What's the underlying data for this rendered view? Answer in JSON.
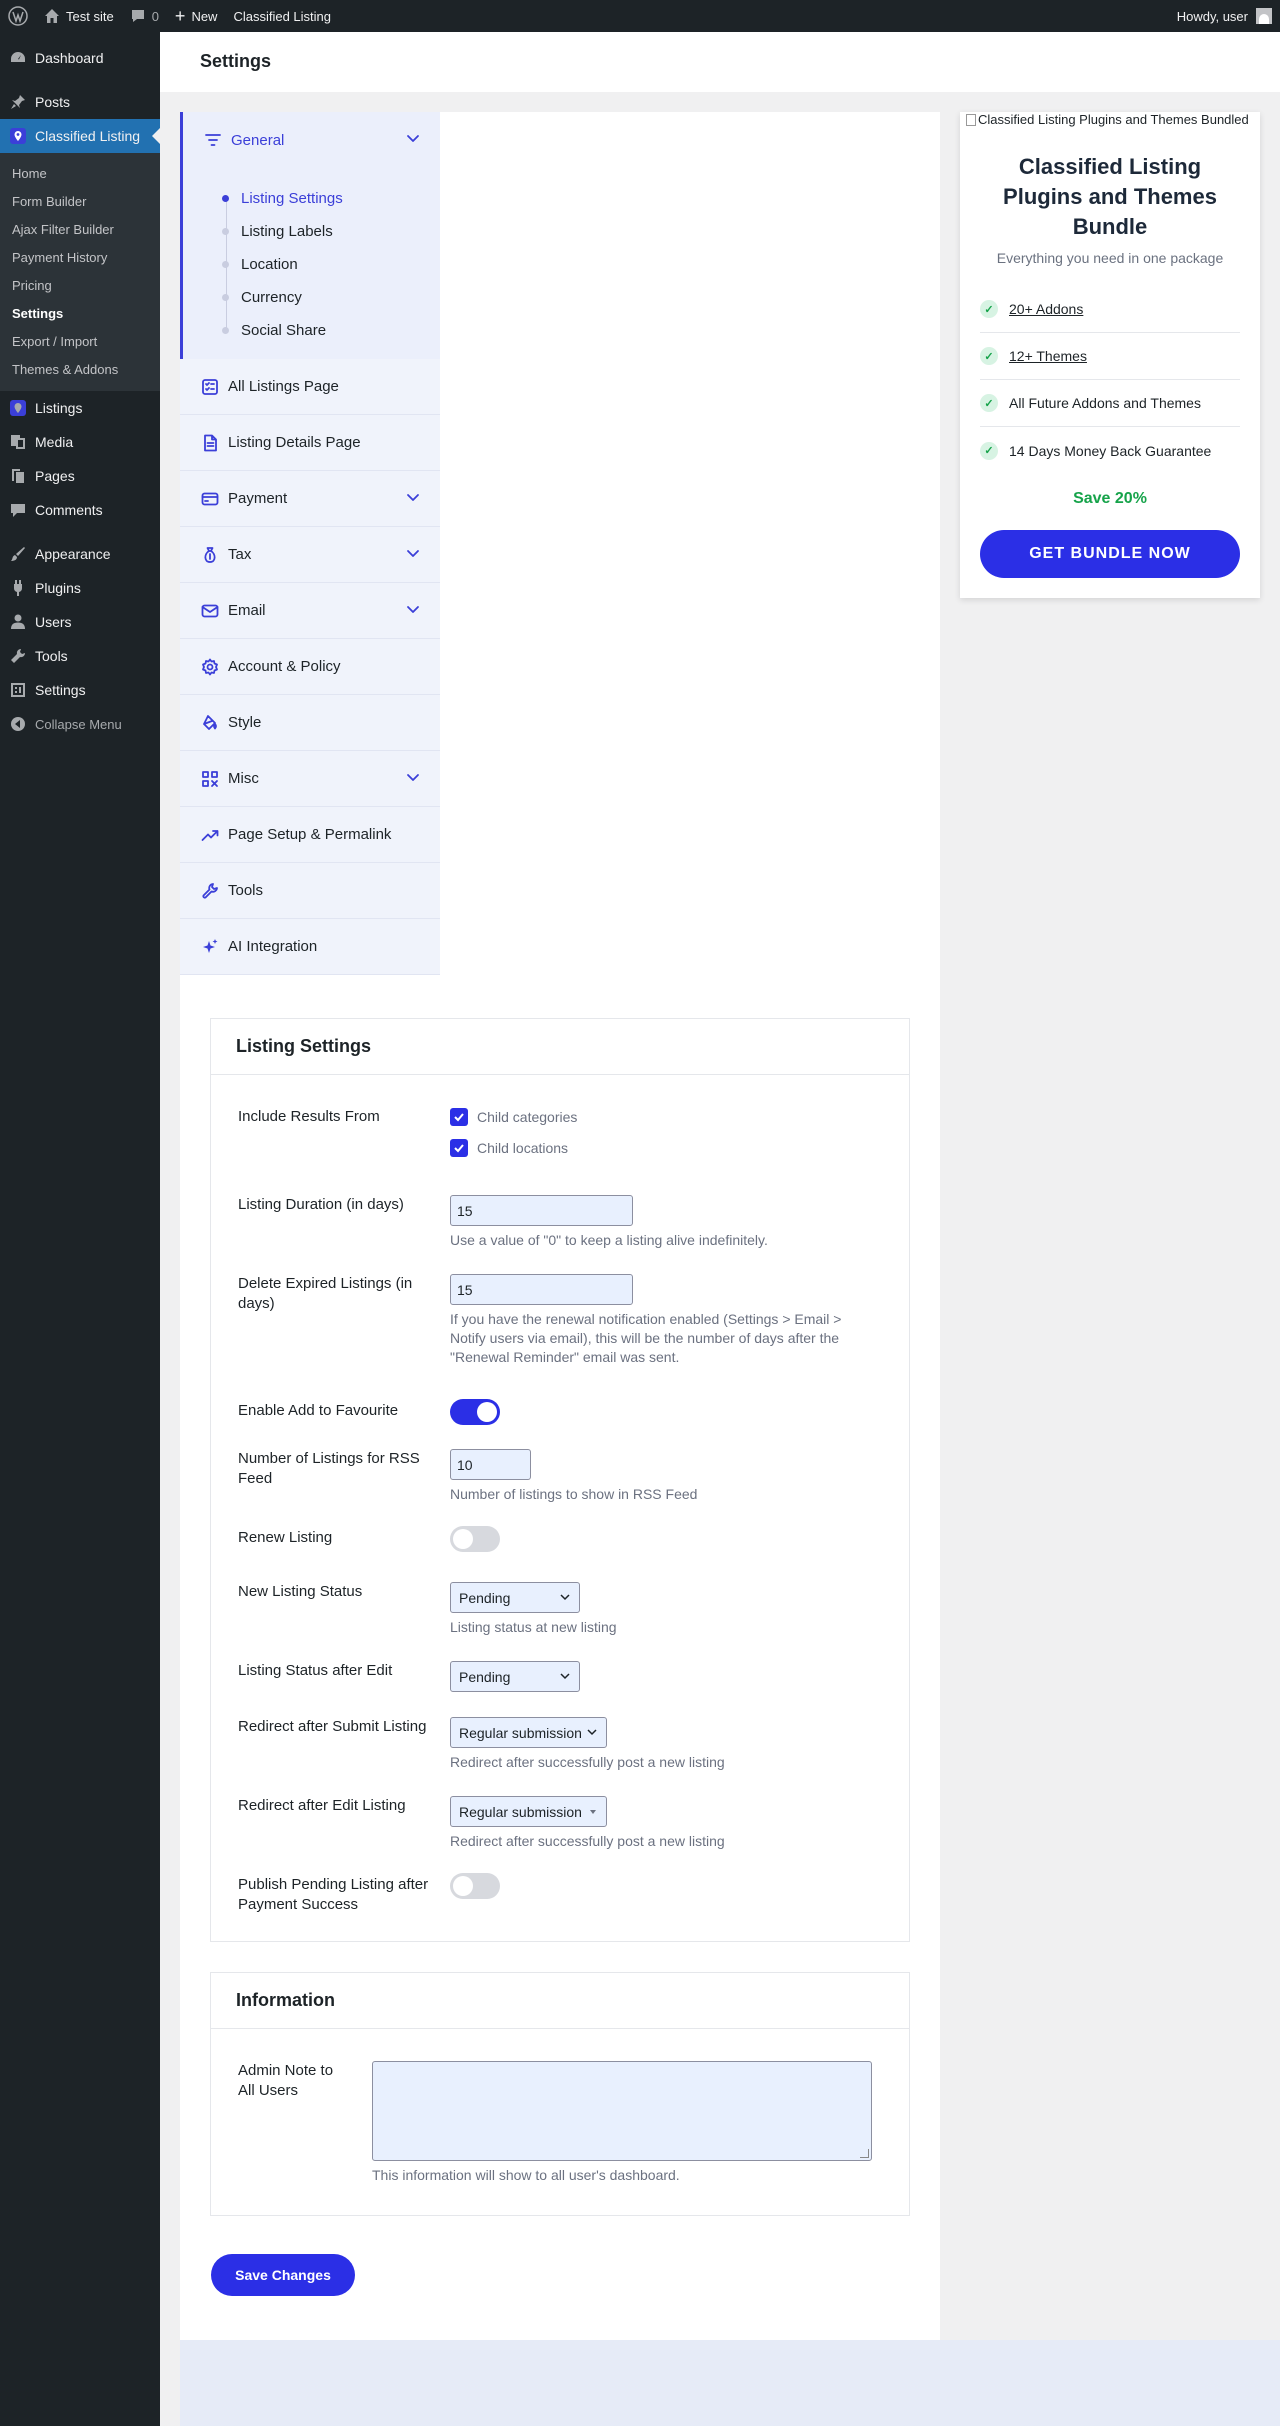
{
  "admin_bar": {
    "site_name": "Test site",
    "comments_count": "0",
    "new_label": "New",
    "plugin_label": "Classified Listing",
    "howdy": "Howdy, user"
  },
  "sidebar": {
    "dashboard": "Dashboard",
    "posts": "Posts",
    "classified_listing": "Classified Listing",
    "submenu": [
      "Home",
      "Form Builder",
      "Ajax Filter Builder",
      "Payment History",
      "Pricing",
      "Settings",
      "Export / Import",
      "Themes & Addons"
    ],
    "listings": "Listings",
    "media": "Media",
    "pages": "Pages",
    "comments": "Comments",
    "appearance": "Appearance",
    "plugins": "Plugins",
    "users": "Users",
    "tools": "Tools",
    "settings": "Settings",
    "collapse": "Collapse Menu"
  },
  "page_title": "Settings",
  "settings_nav": {
    "general": "General",
    "general_sub": [
      "Listing Settings",
      "Listing Labels",
      "Location",
      "Currency",
      "Social Share"
    ],
    "items": [
      {
        "label": "All Listings Page",
        "icon": "list-check-icon"
      },
      {
        "label": "Listing Details Page",
        "icon": "document-icon"
      },
      {
        "label": "Payment",
        "icon": "credit-card-icon"
      },
      {
        "label": "Tax",
        "icon": "money-bag-icon"
      },
      {
        "label": "Email",
        "icon": "envelope-icon"
      },
      {
        "label": "Account & Policy",
        "icon": "gear-icon"
      },
      {
        "label": "Style",
        "icon": "paint-bucket-icon"
      },
      {
        "label": "Misc",
        "icon": "grid-icon"
      },
      {
        "label": "Page Setup & Permalink",
        "icon": "trend-up-icon"
      },
      {
        "label": "Tools",
        "icon": "wrench-icon"
      },
      {
        "label": "AI Integration",
        "icon": "sparkles-icon"
      }
    ]
  },
  "promo": {
    "image_alt": "Classified Listing Plugins and Themes Bundled",
    "title": "Classified Listing Plugins and Themes Bundle",
    "subtitle": "Everything you need in one package",
    "features": [
      "20+ Addons",
      "12+ Themes",
      "All Future Addons and Themes",
      "14 Days Money Back Guarantee"
    ],
    "save": "Save 20%",
    "cta": "GET BUNDLE NOW"
  },
  "listing_settings": {
    "title": "Listing Settings",
    "include_results_label": "Include Results From",
    "child_categories": "Child categories",
    "child_locations": "Child locations",
    "duration_label": "Listing Duration (in days)",
    "duration_value": "15",
    "duration_desc": "Use a value of \"0\" to keep a listing alive indefinitely.",
    "delete_expired_label": "Delete Expired Listings (in days)",
    "delete_expired_value": "15",
    "delete_expired_desc": "If you have the renewal notification enabled (Settings > Email > Notify users via email), this will be the number of days after the \"Renewal Reminder\" email was sent.",
    "favourite_label": "Enable Add to Favourite",
    "favourite_enabled": true,
    "rss_label": "Number of Listings for RSS Feed",
    "rss_value": "10",
    "rss_desc": "Number of listings to show in RSS Feed",
    "renew_label": "Renew Listing",
    "renew_enabled": false,
    "new_status_label": "New Listing Status",
    "new_status_value": "Pending",
    "new_status_desc": "Listing status at new listing",
    "status_after_edit_label": "Listing Status after Edit",
    "status_after_edit_value": "Pending",
    "redirect_submit_label": "Redirect after Submit Listing",
    "redirect_submit_value": "Regular submission",
    "redirect_submit_desc": "Redirect after successfully post a new listing",
    "redirect_edit_label": "Redirect after Edit Listing",
    "redirect_edit_value": "Regular submission",
    "redirect_edit_desc": "Redirect after successfully post a new listing",
    "publish_pending_label": "Publish Pending Listing after Payment Success",
    "publish_pending_enabled": false
  },
  "information": {
    "title": "Information",
    "admin_note_label": "Admin Note to All Users",
    "admin_note_value": "",
    "admin_note_desc": "This information will show to all user's dashboard."
  },
  "save_button": "Save Changes",
  "colors": {
    "accent": "#2b2fe6",
    "wp_blue": "#2271b1",
    "admin_dark": "#1d2327",
    "success": "#16a34a"
  }
}
